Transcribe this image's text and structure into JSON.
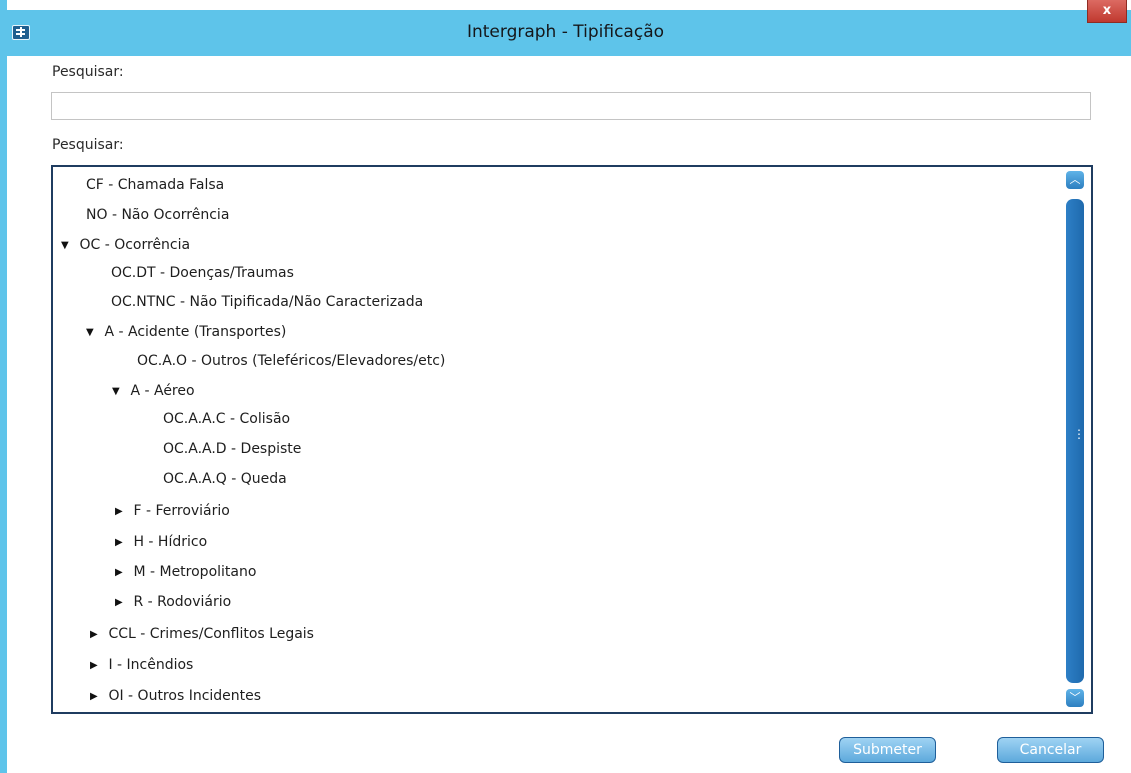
{
  "window": {
    "title": "Intergraph - Tipificação",
    "close_label": "x"
  },
  "search": {
    "label": "Pesquisar:",
    "value": "",
    "placeholder": ""
  },
  "tree": {
    "label": "Pesquisar:",
    "items": [
      {
        "label": "CF - Chamada Falsa",
        "toggle": ""
      },
      {
        "label": "NO - Não Ocorrência",
        "toggle": ""
      },
      {
        "label": "OC - Ocorrência",
        "toggle": "▼"
      },
      {
        "label": "OC.DT - Doenças/Traumas",
        "toggle": ""
      },
      {
        "label": "OC.NTNC - Não Tipificada/Não Caracterizada",
        "toggle": ""
      },
      {
        "label": "A - Acidente (Transportes)",
        "toggle": "▼"
      },
      {
        "label": "OC.A.O - Outros (Teleféricos/Elevadores/etc)",
        "toggle": ""
      },
      {
        "label": "A - Aéreo",
        "toggle": "▼"
      },
      {
        "label": "OC.A.A.C - Colisão",
        "toggle": ""
      },
      {
        "label": "OC.A.A.D - Despiste",
        "toggle": ""
      },
      {
        "label": "OC.A.A.Q - Queda",
        "toggle": ""
      },
      {
        "label": "F - Ferroviário",
        "toggle": "▶"
      },
      {
        "label": "H - Hídrico",
        "toggle": "▶"
      },
      {
        "label": "M - Metropolitano",
        "toggle": "▶"
      },
      {
        "label": "R - Rodoviário",
        "toggle": "▶"
      },
      {
        "label": "CCL - Crimes/Conflitos Legais",
        "toggle": "▶"
      },
      {
        "label": "I - Incêndios",
        "toggle": "▶"
      },
      {
        "label": "OI - Outros Incidentes",
        "toggle": "▶"
      }
    ]
  },
  "scrollbar": {
    "up_icon": "chevron-up-icon",
    "down_icon": "chevron-down-icon",
    "up_glyph": "︿",
    "down_glyph": "﹀",
    "grip_glyph": "⋮"
  },
  "buttons": {
    "submit_label": "Submeter",
    "cancel_label": "Cancelar"
  },
  "colors": {
    "title_bar": "#5ec4ea",
    "close_button": "#c0392f",
    "tree_border": "#1f3c60",
    "scrollbar": "#2d7fc6",
    "button": "#5da9dc"
  }
}
